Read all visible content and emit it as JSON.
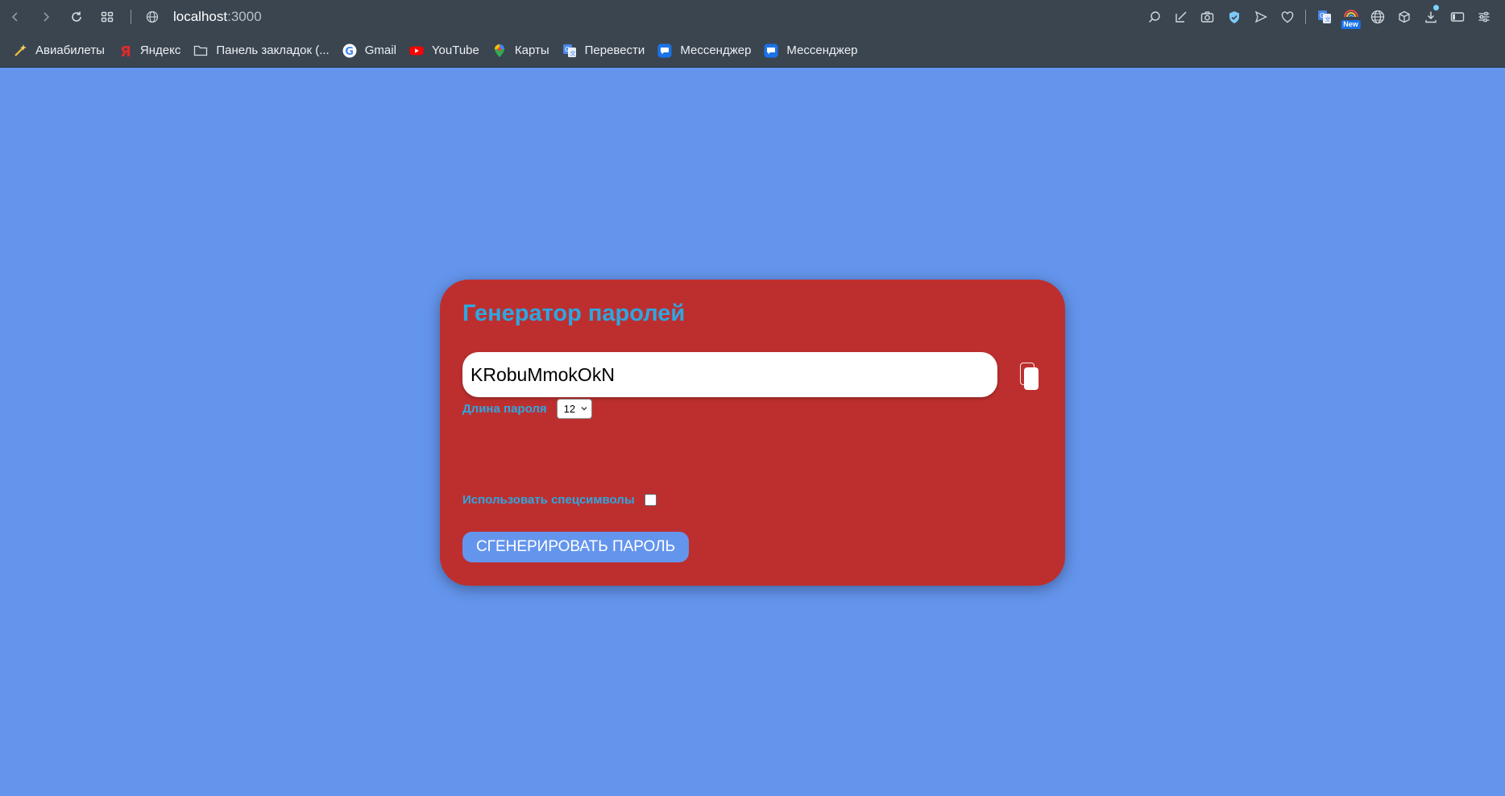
{
  "browser": {
    "url_host": "localhost",
    "url_port": ":3000",
    "toolbar_icons": [
      "search-page-icon",
      "screenshot-edit-icon",
      "camera-icon",
      "shield-icon",
      "send-icon",
      "heart-icon",
      "translate-icon",
      "rainbow-icon",
      "globe-icon",
      "cube-icon",
      "download-icon",
      "sidebar-icon",
      "settings-icon"
    ],
    "new_badge": "New"
  },
  "bookmarks": [
    {
      "label": "Авиабилеты",
      "icon": "magic-wand-icon"
    },
    {
      "label": "Яндекс",
      "icon": "yandex-icon"
    },
    {
      "label": "Панель закладок (...",
      "icon": "folder-icon"
    },
    {
      "label": "Gmail",
      "icon": "google-icon"
    },
    {
      "label": "YouTube",
      "icon": "youtube-icon"
    },
    {
      "label": "Карты",
      "icon": "maps-pin-icon"
    },
    {
      "label": "Перевести",
      "icon": "translate-icon"
    },
    {
      "label": "Мессенджер",
      "icon": "messenger-icon"
    },
    {
      "label": "Мессенджер",
      "icon": "messenger-icon"
    }
  ],
  "app": {
    "title": "Генератор паролей",
    "password": "KRobuMmokOkN",
    "length_label": "Длина пароля",
    "length_value": "12",
    "special_label": "Использовать спецсимволы",
    "special_checked": false,
    "generate_label": "СГЕНЕРИРОВАТЬ ПАРОЛЬ"
  },
  "colors": {
    "background": "#6495ed",
    "card": "#bd2f2f",
    "accent_text": "#2ea7e0",
    "button": "#6495ed"
  }
}
